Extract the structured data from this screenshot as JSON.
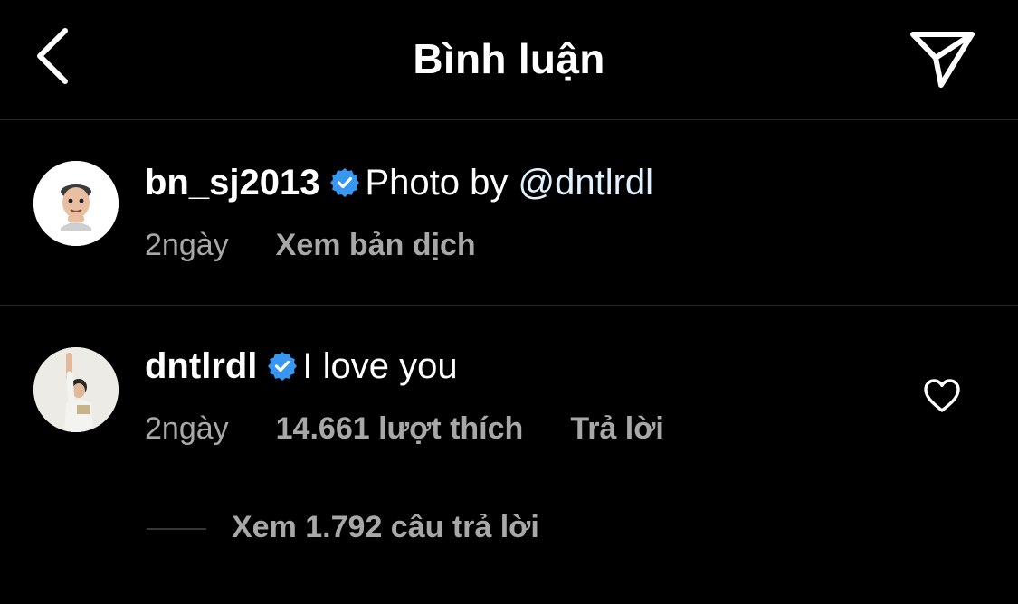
{
  "header": {
    "title": "Bình luận",
    "back_icon": "chevron-left-icon",
    "send_icon": "paper-plane-icon"
  },
  "caption": {
    "username": "bn_sj2013",
    "verified": true,
    "text_prefix": "Photo by ",
    "mention": "@dntlrdl",
    "time": "2ngày",
    "translate_label": "Xem bản dịch",
    "avatar_icon": "memoji-avatar"
  },
  "comment": {
    "username": "dntlrdl",
    "verified": true,
    "text": "I love you",
    "time": "2ngày",
    "likes_label": "14.661 lượt thích",
    "reply_label": "Trả lời",
    "like_icon": "heart-outline-icon",
    "avatar_icon": "photo-avatar"
  },
  "replies": {
    "view_label": "Xem 1.792 câu trả lời"
  },
  "colors": {
    "background": "#000000",
    "text": "#ffffff",
    "secondary": "#a8a8a8",
    "verified_blue": "#3897f0",
    "mention": "#e0f1ff",
    "divider": "#262626"
  }
}
